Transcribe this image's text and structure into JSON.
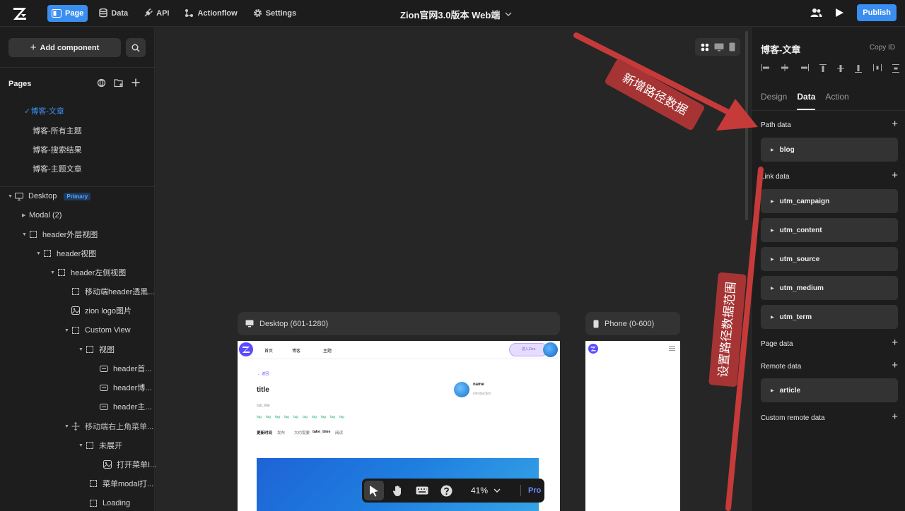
{
  "topbar": {
    "nav": [
      {
        "label": "Page",
        "icon": "page-icon"
      },
      {
        "label": "Data",
        "icon": "database-icon"
      },
      {
        "label": "API",
        "icon": "plug-icon"
      },
      {
        "label": "Actionflow",
        "icon": "flow-icon"
      },
      {
        "label": "Settings",
        "icon": "gear-icon"
      }
    ],
    "doc_title": "Zion官网3.0版本 Web端",
    "publish_label": "Publish"
  },
  "left": {
    "add_component": "Add component",
    "pages_title": "Pages",
    "pages": [
      "博客-文章",
      "博客-所有主题",
      "博客-搜索结果",
      "博客-主题文章"
    ],
    "tree": [
      {
        "label": "Desktop",
        "badge": "Primary"
      },
      {
        "label": "Modal (2)"
      },
      {
        "label": "header外层视图"
      },
      {
        "label": "header视图"
      },
      {
        "label": "header左侧视图"
      },
      {
        "label": "移动端header透黑..."
      },
      {
        "label": "zion logo图片"
      },
      {
        "label": "Custom View"
      },
      {
        "label": "视图"
      },
      {
        "label": "header首..."
      },
      {
        "label": "header博..."
      },
      {
        "label": "header主..."
      },
      {
        "label": "移动端右上角菜单..."
      },
      {
        "label": "未展开"
      },
      {
        "label": "打开菜单I..."
      },
      {
        "label": "菜单modal打..."
      },
      {
        "label": "Loading"
      }
    ]
  },
  "canvas": {
    "desktop_label": "Desktop (601-1280)",
    "phone_label": "Phone (0-600)",
    "preview": {
      "nav": [
        "首页",
        "博客",
        "主题"
      ],
      "enter_btn": "进入Zion",
      "back": "← 返回",
      "title": "title",
      "author_name": "name",
      "author_intro": "introduction",
      "sub_title": "sub_title",
      "tag": "tag",
      "meta_update": "更新时间",
      "meta_publish": "发布",
      "meta_need": "大约需要",
      "meta_time": "take_time",
      "meta_read": "阅读"
    },
    "zoom": "41%",
    "pro": "Pro"
  },
  "right": {
    "component_name": "博客-文章",
    "copy_id": "Copy ID",
    "tabs": [
      "Design",
      "Data",
      "Action"
    ],
    "active_tab": "Data",
    "path_data_title": "Path data",
    "path_data": [
      "blog"
    ],
    "link_data_title": "Link data",
    "link_data": [
      "utm_campaign",
      "utm_content",
      "utm_source",
      "utm_medium",
      "utm_term"
    ],
    "page_data_title": "Page data",
    "remote_data_title": "Remote data",
    "remote_data": [
      "article"
    ],
    "custom_remote_title": "Custom remote data"
  },
  "annotations": {
    "label_1": "新增路径数据",
    "label_2": "设置路径数据范围",
    "color": "#c0392b"
  }
}
